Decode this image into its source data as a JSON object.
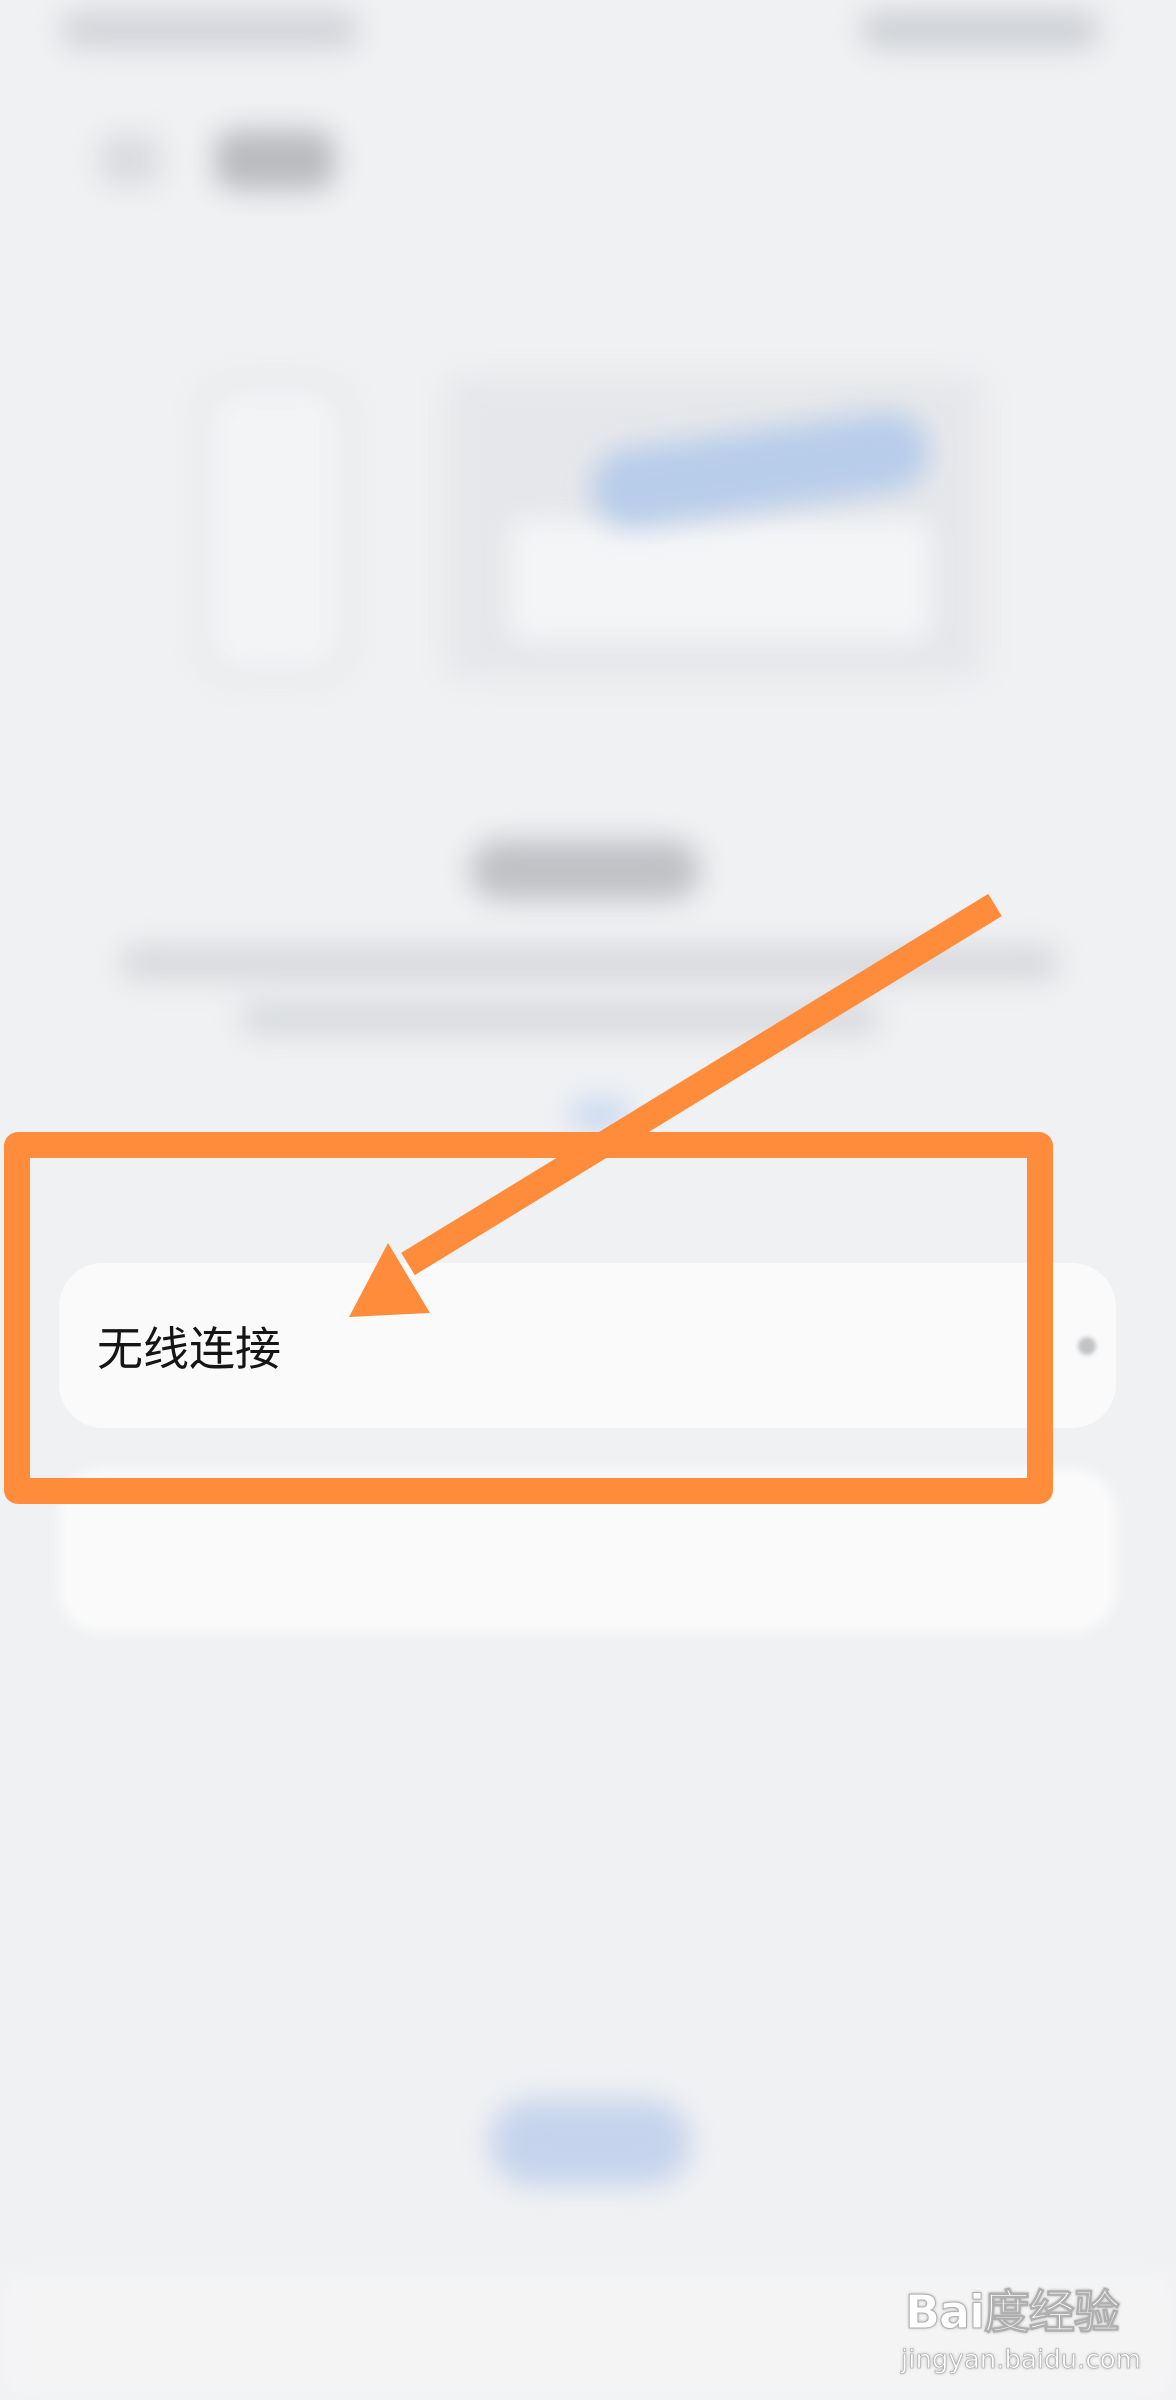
{
  "settings_list": {
    "wireless_connection_label": "无线连接"
  },
  "annotation": {
    "color": "#ff8c3a"
  },
  "watermark": {
    "brand": "Bai度经验",
    "url": "jingyan.baidu.com"
  },
  "colors": {
    "background": "#f0f1f3",
    "card": "#fafafa",
    "text": "#151515"
  }
}
